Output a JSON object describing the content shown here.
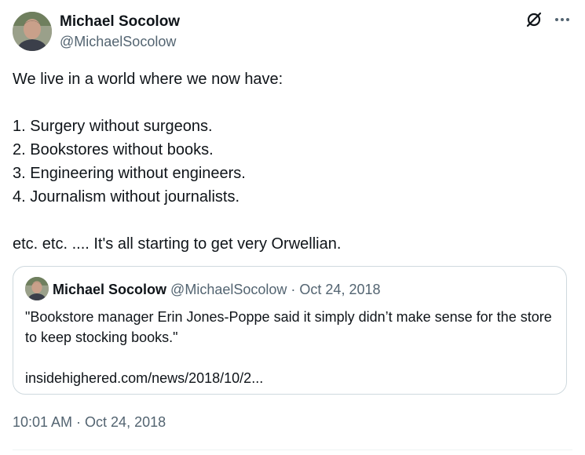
{
  "author": {
    "name": "Michael Socolow",
    "handle": "@MichaelSocolow"
  },
  "icons": {
    "grok": "slashed-circle-icon",
    "more": "more-dots-icon"
  },
  "tweet": {
    "intro": "We live in a world where we now have:",
    "items": [
      "1. Surgery without surgeons.",
      "2. Bookstores without books.",
      "3. Engineering without engineers.",
      "4. Journalism without journalists."
    ],
    "closing": "etc. etc. .... It's all starting to get very Orwellian."
  },
  "quote": {
    "name": "Michael Socolow",
    "handle": "@MichaelSocolow",
    "separator": "·",
    "date": "Oct 24, 2018",
    "text": "\"Bookstore manager Erin Jones-Poppe said it simply didn’t make sense for the store to keep stocking books.\"",
    "link": "insidehighered.com/news/2018/10/2..."
  },
  "timestamp": "10:01 AM · Oct 24, 2018",
  "colors": {
    "text": "#0f1419",
    "secondary": "#536471",
    "border": "#cfd9de"
  }
}
